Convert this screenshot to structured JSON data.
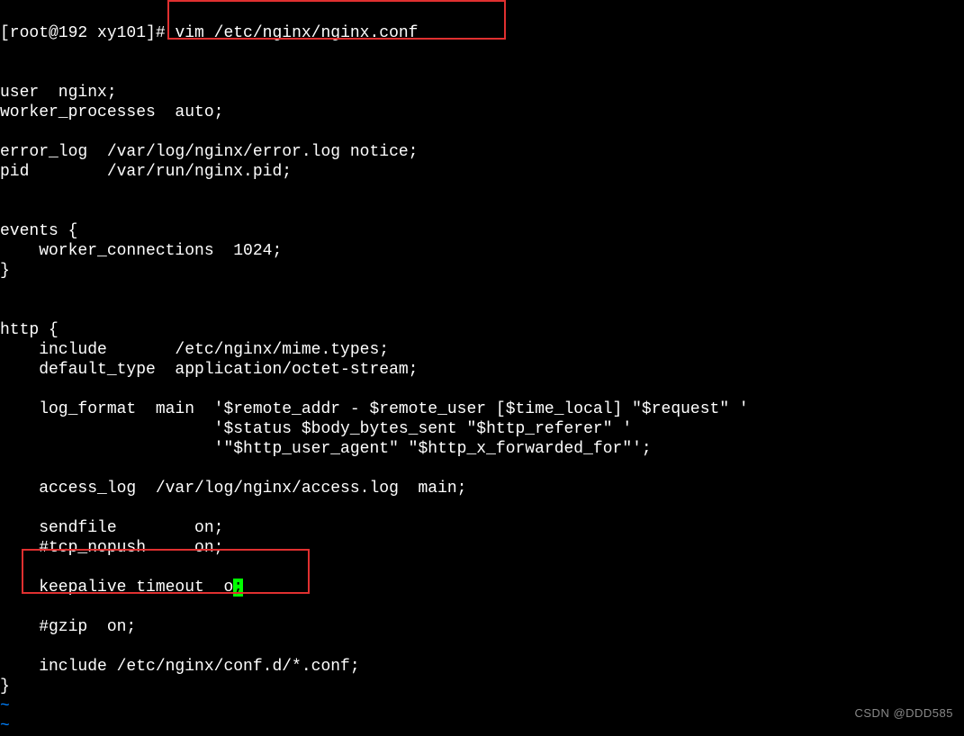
{
  "prompt": {
    "user_host": "[root@192 xy101]#",
    "command": " vim /etc/nginx/nginx.conf"
  },
  "lines": {
    "l01": "",
    "l02": "",
    "l03": "user  nginx;",
    "l04": "worker_processes  auto;",
    "l05": "",
    "l06": "error_log  /var/log/nginx/error.log notice;",
    "l07": "pid        /var/run/nginx.pid;",
    "l08": "",
    "l09": "",
    "l10": "events {",
    "l11": "    worker_connections  1024;",
    "l12": "}",
    "l13": "",
    "l14": "",
    "l15": "http {",
    "l16": "    include       /etc/nginx/mime.types;",
    "l17": "    default_type  application/octet-stream;",
    "l18": "",
    "l19": "    log_format  main  '$remote_addr - $remote_user [$time_local] \"$request\" '",
    "l20": "                      '$status $body_bytes_sent \"$http_referer\" '",
    "l21": "                      '\"$http_user_agent\" \"$http_x_forwarded_for\"';",
    "l22": "",
    "l23": "    access_log  /var/log/nginx/access.log  main;",
    "l24": "",
    "l25": "    sendfile        on;",
    "l26": "    #tcp_nopush     on;",
    "l27": "",
    "l28_pre": "    keepalive_timeout  o",
    "l28_cursor": ";",
    "l29": "",
    "l30": "    #gzip  on;",
    "l31": "",
    "l32": "    include /etc/nginx/conf.d/*.conf;",
    "l33": "}",
    "tilde1": "~",
    "tilde2": "~"
  },
  "watermark": "CSDN @DDD585"
}
